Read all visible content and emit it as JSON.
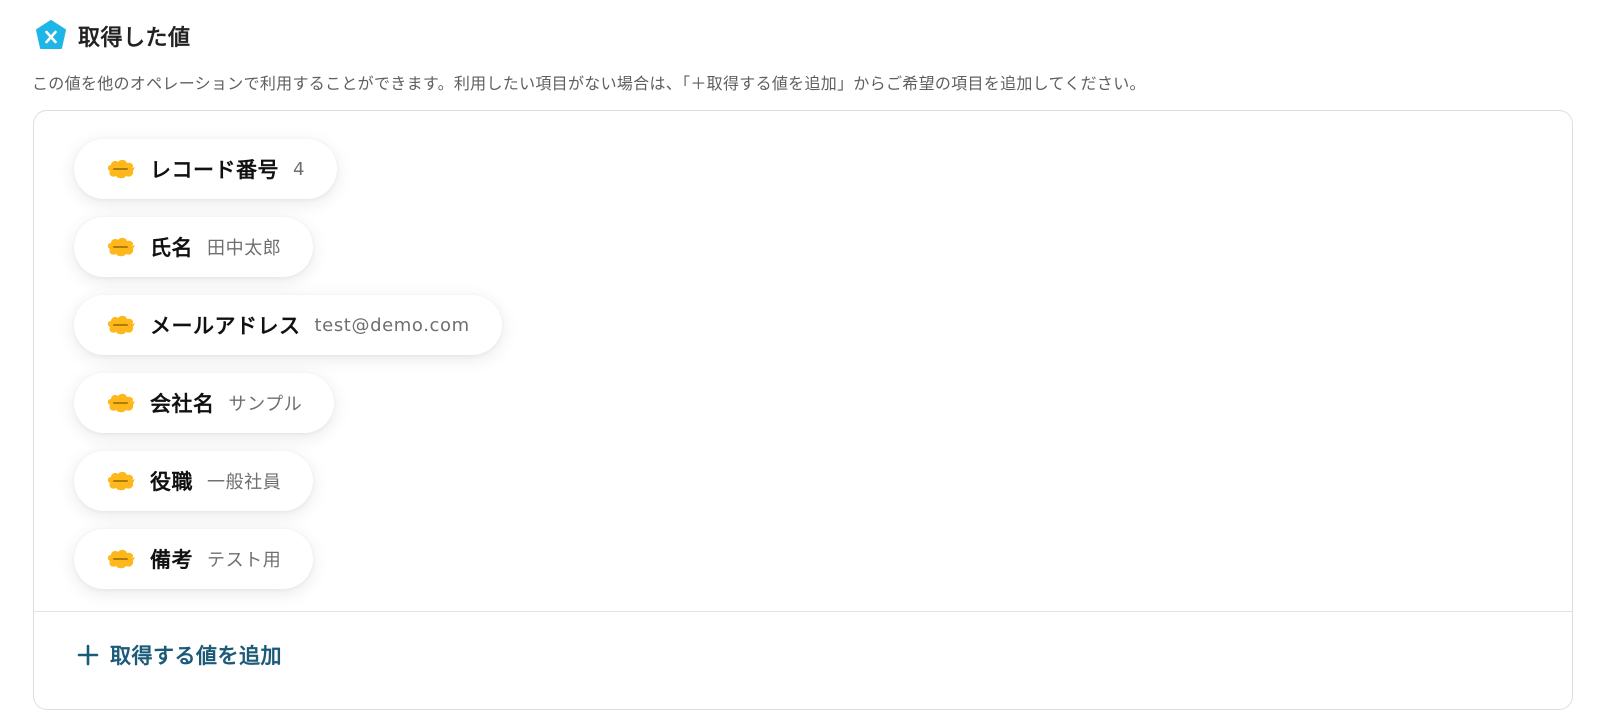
{
  "header": {
    "title": "取得した値",
    "icon": "yoom-x-hexagon-icon",
    "icon_color": "#1EB6E6"
  },
  "description": "この値を他のオペレーションで利用することができます。利用したい項目がない場合は、「＋取得する値を追加」からご希望の項目を追加してください。",
  "values": [
    {
      "label": "レコード番号",
      "value": "4",
      "icon": "kintone-icon"
    },
    {
      "label": "氏名",
      "value": "田中太郎",
      "icon": "kintone-icon"
    },
    {
      "label": "メールアドレス",
      "value": "test@demo.com",
      "icon": "kintone-icon"
    },
    {
      "label": "会社名",
      "value": "サンプル",
      "icon": "kintone-icon"
    },
    {
      "label": "役職",
      "value": "一般社員",
      "icon": "kintone-icon"
    },
    {
      "label": "備考",
      "value": "テスト用",
      "icon": "kintone-icon"
    }
  ],
  "add_button": {
    "label": "取得する値を追加",
    "icon": "plus-icon",
    "color": "#1B5A78"
  },
  "colors": {
    "kintone_yellow": "#FFB81C",
    "description_text": "#5F5F5F",
    "value_text": "#6F6F6F"
  }
}
